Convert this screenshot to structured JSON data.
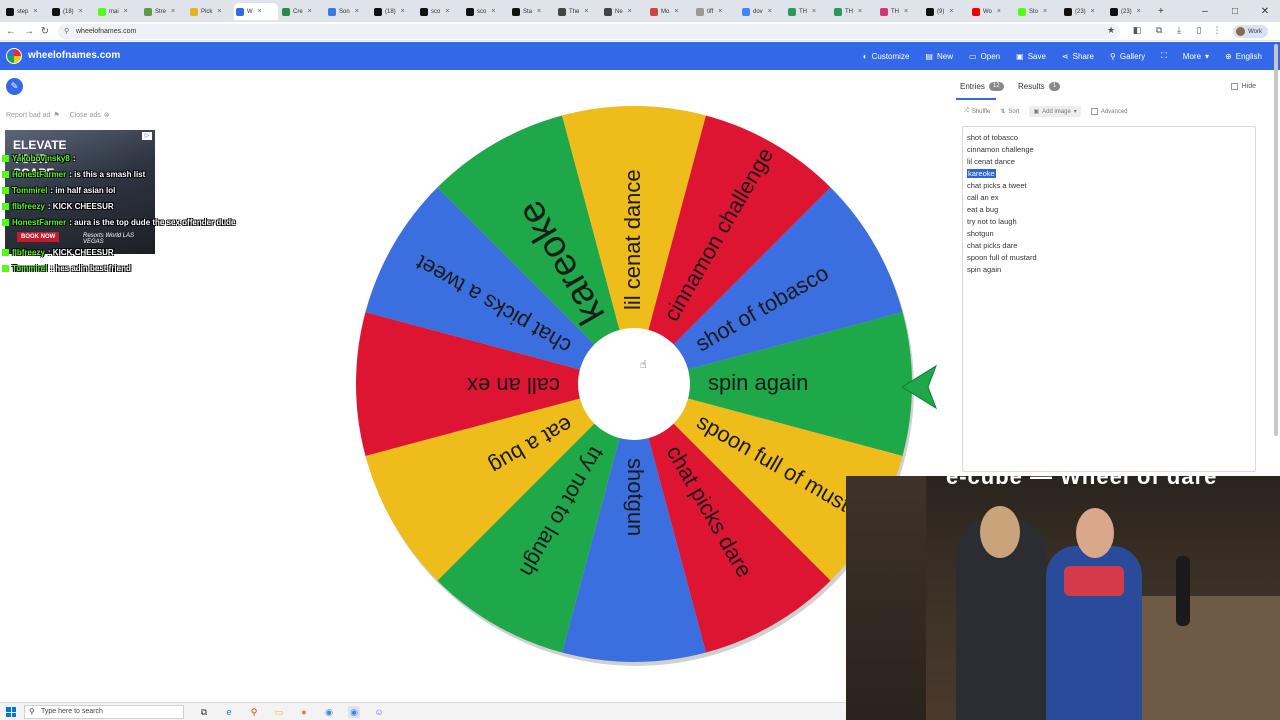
{
  "browser": {
    "tabs": [
      {
        "label": "step",
        "icon": "x-icon",
        "color": "#111111"
      },
      {
        "label": "(18)",
        "icon": "x-icon",
        "color": "#111111"
      },
      {
        "label": "mai",
        "icon": "kick-icon",
        "color": "#53fc18"
      },
      {
        "label": "Stre",
        "icon": "stream-icon",
        "color": "#5a9a4a"
      },
      {
        "label": "Pick",
        "icon": "picker-icon",
        "color": "#e6b422"
      },
      {
        "label": "W",
        "icon": "wheel-icon",
        "color": "#3369e8",
        "active": true
      },
      {
        "label": "Cre",
        "icon": "create-icon",
        "color": "#2a8a4a"
      },
      {
        "label": "Son",
        "icon": "song-icon",
        "color": "#3a7ae0"
      },
      {
        "label": "(18)",
        "icon": "x-icon",
        "color": "#111111"
      },
      {
        "label": "sco",
        "icon": "x-icon",
        "color": "#111111"
      },
      {
        "label": "sco",
        "icon": "x-icon",
        "color": "#111111"
      },
      {
        "label": "Sta",
        "icon": "star-icon",
        "color": "#111111"
      },
      {
        "label": "The",
        "icon": "the-icon",
        "color": "#444444"
      },
      {
        "label": "Ne",
        "icon": "news-icon",
        "color": "#444444"
      },
      {
        "label": "Mo",
        "icon": "movie-icon",
        "color": "#c44"
      },
      {
        "label": "tiff",
        "icon": "tiff-icon",
        "color": "#999999"
      },
      {
        "label": "dov",
        "icon": "google-icon",
        "color": "#4285f4"
      },
      {
        "label": "TH",
        "icon": "th-icon",
        "color": "#2a9a5a"
      },
      {
        "label": "TH",
        "icon": "th-icon",
        "color": "#2a9a5a"
      },
      {
        "label": "TH",
        "icon": "instagram-icon",
        "color": "#d6336c"
      },
      {
        "label": "(9)",
        "icon": "x-icon",
        "color": "#111111"
      },
      {
        "label": "Wo",
        "icon": "youtube-icon",
        "color": "#ee0000"
      },
      {
        "label": "Sto",
        "icon": "kick-icon",
        "color": "#53fc18"
      },
      {
        "label": "(23)",
        "icon": "x-icon",
        "color": "#111111"
      },
      {
        "label": "(23)",
        "icon": "x-icon",
        "color": "#111111"
      }
    ],
    "new_tab": "+",
    "window_controls": [
      "–",
      "□",
      "✕"
    ],
    "url": "wheelofnames.com",
    "profile_label": "Work"
  },
  "site": {
    "name": "wheelofnames.com",
    "menu": [
      {
        "label": "Customize",
        "icon": "palette-icon"
      },
      {
        "label": "New",
        "icon": "new-file-icon"
      },
      {
        "label": "Open",
        "icon": "folder-icon"
      },
      {
        "label": "Save",
        "icon": "save-icon"
      },
      {
        "label": "Share",
        "icon": "share-icon"
      },
      {
        "label": "Gallery",
        "icon": "search-icon"
      },
      {
        "label": "",
        "icon": "fullscreen-icon"
      },
      {
        "label": "More",
        "icon": "chevron-down-icon"
      },
      {
        "label": "English",
        "icon": "globe-icon"
      }
    ],
    "colors": {
      "header": "#3369e8",
      "green": "#1ea84a",
      "red": "#dd1533",
      "yellow": "#eebd1c",
      "blue": "#3b6fe0"
    }
  },
  "ads": {
    "report_label": "Report bad ad",
    "close_label": "Close ads",
    "ad_headline_1": "ELEVATE",
    "ad_headline_2": "YOUR",
    "ad_headline_3": "SCAPE",
    "book_label": "BOOK NOW",
    "brand_label": "Resorts World LAS VEGAS"
  },
  "chat": [
    {
      "user": "Yakobovinsky8",
      "msg": ":"
    },
    {
      "user": "HonestFarmer",
      "msg": ": is this a smash list"
    },
    {
      "user": "Tommirel",
      "msg": ": im half asian lol"
    },
    {
      "user": "flbfreezy",
      "msg": ": KICK CHEESUR"
    },
    {
      "user": "HonestFarmer",
      "msg": ": aura is the top dude the sex offender dude"
    },
    {
      "user": "flbfreezy",
      "msg": ": KICK CHEESUR"
    },
    {
      "user": "Tommirel",
      "msg": ": hes adin best friend"
    }
  ],
  "wheel": {
    "segments": [
      {
        "label": "spin again",
        "color": "green"
      },
      {
        "label": "spoon full of mustard",
        "color": "yellow"
      },
      {
        "label": "chat picks dare",
        "color": "red"
      },
      {
        "label": "shotgun",
        "color": "blue"
      },
      {
        "label": "try not to laugh",
        "color": "green"
      },
      {
        "label": "eat a bug",
        "color": "yellow"
      },
      {
        "label": "call an ex",
        "color": "red"
      },
      {
        "label": "chat picks a tweet",
        "color": "blue"
      },
      {
        "label": "kareoke",
        "color": "green"
      },
      {
        "label": "lil cenat dance",
        "color": "yellow"
      },
      {
        "label": "cinnamon challenge",
        "color": "red"
      },
      {
        "label": "shot of tobasco",
        "color": "blue"
      }
    ]
  },
  "panel": {
    "entries_tab": "Entries",
    "entries_count": "12",
    "results_tab": "Results",
    "results_count": "1",
    "hide_label": "Hide",
    "tools": {
      "shuffle": "Shuffle",
      "sort": "Sort",
      "add_image": "Add image",
      "advanced": "Advanced"
    },
    "entries": [
      "shot of tobasco",
      "cinnamon challenge",
      "lil cenat dance",
      "kareoke",
      "chat picks a tweet",
      "call an ex",
      "eat a bug",
      "try not to laugh",
      "shotgun",
      "chat picks dare",
      "spoon full of mustard",
      "spin again"
    ],
    "selected_entry": "kareoke"
  },
  "webcam": {
    "overlay_title": "e-cube — Wheel of dare"
  },
  "taskbar": {
    "search_placeholder": "Type here to search",
    "apps": [
      {
        "icon": "task-view-icon",
        "color": "#333333"
      },
      {
        "icon": "edge-icon",
        "color": "#0f8ad6"
      },
      {
        "icon": "search-app-icon",
        "color": "#d83b01"
      },
      {
        "icon": "file-explorer-icon",
        "color": "#e8b422"
      },
      {
        "icon": "firefox-icon",
        "color": "#ff7139"
      },
      {
        "icon": "chrome-icon",
        "color": "#4285f4"
      },
      {
        "icon": "chrome-icon",
        "color": "#4285f4"
      },
      {
        "icon": "discord-icon",
        "color": "#5865f2"
      }
    ]
  }
}
